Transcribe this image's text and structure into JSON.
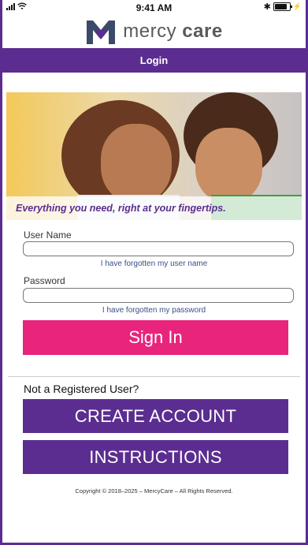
{
  "status_bar": {
    "time": "9:41 AM",
    "bluetooth": "✱",
    "battery": "battery-icon"
  },
  "brand": {
    "name_light": "mercy ",
    "name_bold": "care",
    "logo_color": "#3b4a6b",
    "heart_color": "#5b2d90"
  },
  "header": {
    "title": "Login"
  },
  "hero": {
    "caption": "Everything you need, right at your fingertips."
  },
  "form": {
    "username_label": "User Name",
    "username_value": "",
    "forgot_username": "I have forgotten my user name",
    "password_label": "Password",
    "password_value": "",
    "forgot_password": "I have forgotten my password",
    "sign_in": "Sign In"
  },
  "registration": {
    "prompt": "Not a Registered User?",
    "create_account": "CREATE ACCOUNT",
    "instructions": "INSTRUCTIONS"
  },
  "footer": {
    "copyright": "Copyright © 2018–2025 – MercyCare – All Rights Reserved."
  },
  "colors": {
    "purple": "#5b2d90",
    "pink": "#e8247c"
  }
}
